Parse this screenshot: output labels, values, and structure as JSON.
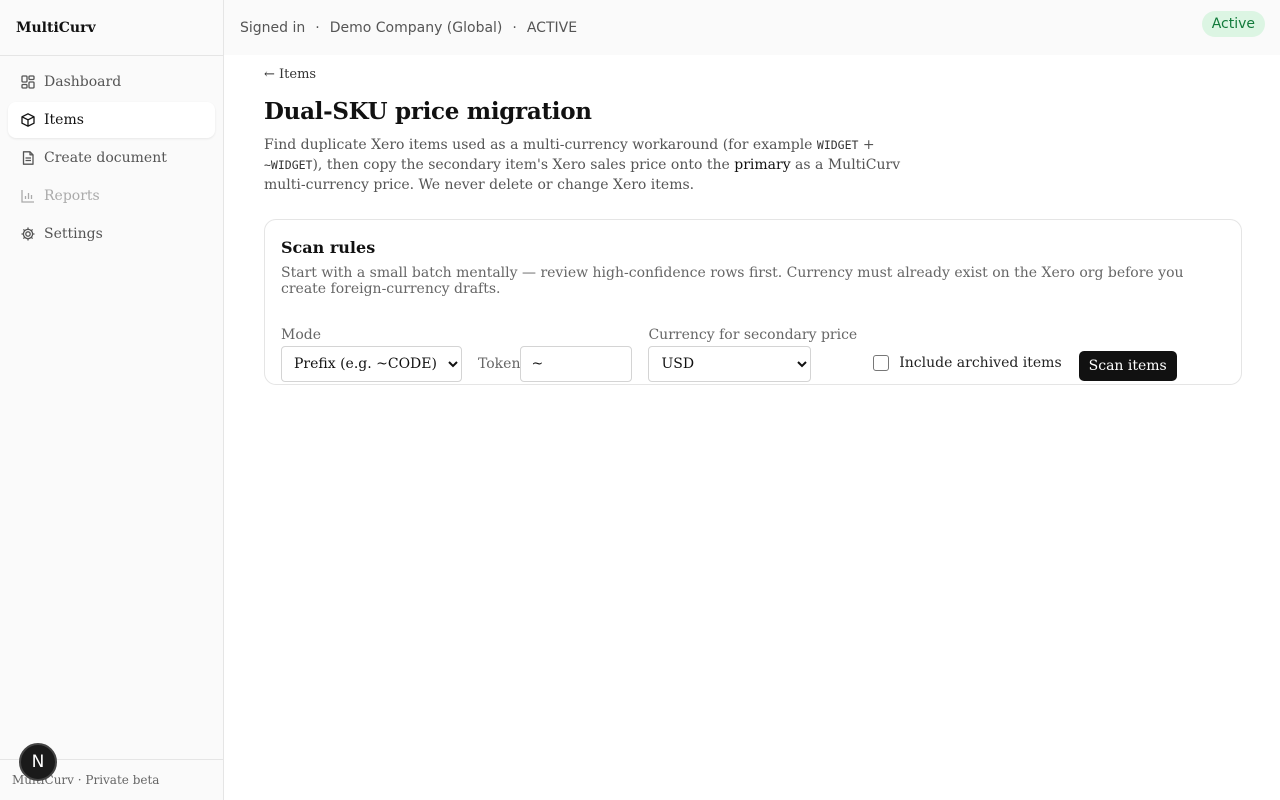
{
  "app": {
    "brand": "MultiCurv",
    "footer": "MultiCurv · Private beta",
    "fab_letter": "N"
  },
  "sidebar": {
    "items": [
      {
        "label": "Dashboard",
        "icon": "dashboard-icon"
      },
      {
        "label": "Items",
        "icon": "cube-icon",
        "active": true
      },
      {
        "label": "Create document",
        "icon": "document-icon"
      },
      {
        "label": "Reports",
        "icon": "bar-chart-icon",
        "disabled": true
      },
      {
        "label": "Settings",
        "icon": "gear-icon"
      }
    ]
  },
  "topbar": {
    "signed_in": "Signed in",
    "separator": "·",
    "org": "Demo Company (Global)",
    "status": "ACTIVE",
    "badge": "Active",
    "badge_color": "#127a3b"
  },
  "page": {
    "back_link": "← Items",
    "title": "Dual-SKU price migration",
    "desc_part1": "Find duplicate Xero items used as a multi-currency workaround (for example ",
    "desc_code1": "WIDGET",
    "desc_plus": " + ",
    "desc_code2": "~WIDGET",
    "desc_part2": "), then copy the secondary item's Xero sales price onto the ",
    "desc_strong": "primary",
    "desc_part3": " as a MultiCurv multi-currency price. We never delete or change Xero items."
  },
  "scan": {
    "title": "Scan rules",
    "subtitle": "Start with a small batch mentally — review high-confidence rows first. Currency must already exist on the Xero org before you create foreign-currency drafts.",
    "mode_label": "Mode",
    "mode_value": "Prefix (e.g. ~CODE)",
    "token_label": "Token",
    "token_value": "~",
    "currency_label": "Currency for secondary price",
    "currency_value": "USD",
    "archived_label": "Include archived items",
    "scan_button": "Scan items"
  }
}
